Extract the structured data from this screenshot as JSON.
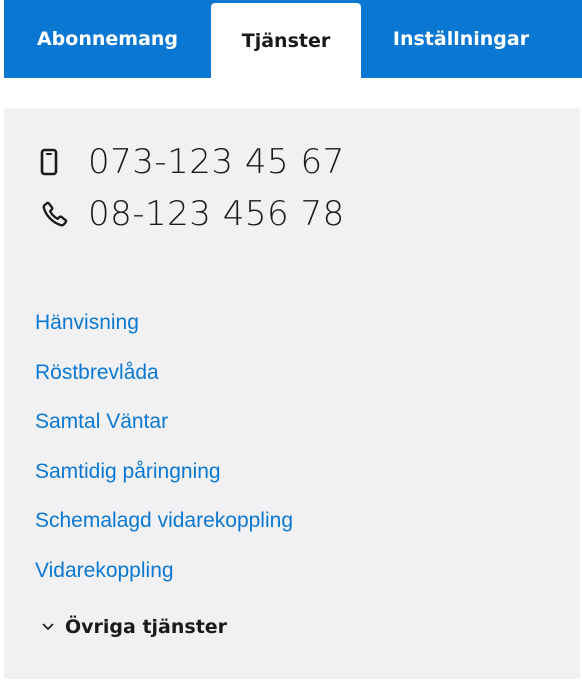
{
  "tabs": [
    {
      "label": "Abonnemang",
      "active": false
    },
    {
      "label": "Tjänster",
      "active": true
    },
    {
      "label": "Inställningar",
      "active": false
    }
  ],
  "numbers": {
    "mobile": {
      "icon": "mobile-phone-icon",
      "value": "073-123 45 67"
    },
    "landline": {
      "icon": "phone-handset-icon",
      "value": "08-123 456 78"
    }
  },
  "services": [
    {
      "label": "Hänvisning"
    },
    {
      "label": "Röstbrevlåda"
    },
    {
      "label": "Samtal Väntar"
    },
    {
      "label": "Samtidig påringning"
    },
    {
      "label": "Schemalagd vidarekoppling"
    },
    {
      "label": "Vidarekoppling"
    }
  ],
  "more_services": {
    "label": "Övriga tjänster",
    "icon": "chevron-down-icon"
  },
  "colors": {
    "brand_blue": "#0a78d2",
    "panel_bg": "#f1f1f3",
    "text_dark": "#1a1a1a"
  }
}
